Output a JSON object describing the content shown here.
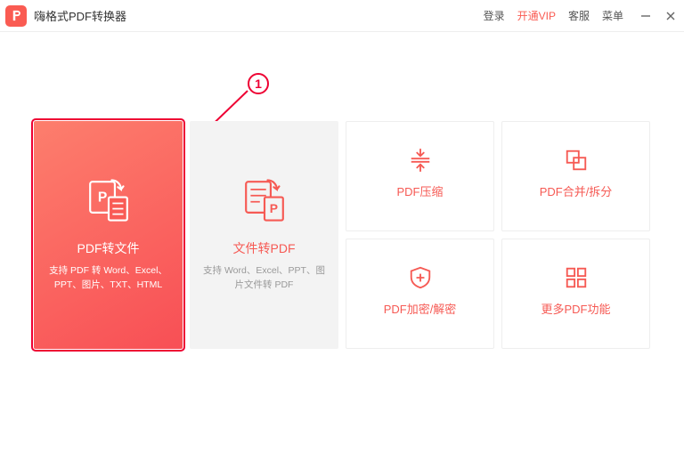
{
  "app": {
    "title": "嗨格式PDF转换器"
  },
  "titlebar": {
    "login": "登录",
    "vip": "开通VIP",
    "support": "客服",
    "menu": "菜单"
  },
  "annotation": {
    "step": "1"
  },
  "cards": {
    "pdf_to_file": {
      "title": "PDF转文件",
      "sub": "支持 PDF 转 Word、Excel、PPT、图片、TXT、HTML"
    },
    "file_to_pdf": {
      "title": "文件转PDF",
      "sub": "支持 Word、Excel、PPT、图片文件转 PDF"
    },
    "compress": {
      "title": "PDF压缩"
    },
    "merge_split": {
      "title": "PDF合并/拆分"
    },
    "encrypt": {
      "title": "PDF加密/解密"
    },
    "more": {
      "title": "更多PDF功能"
    }
  }
}
